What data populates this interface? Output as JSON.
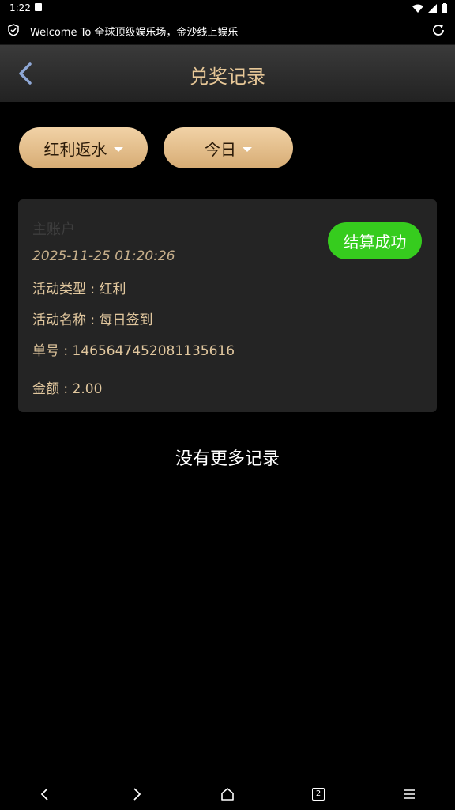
{
  "status_bar": {
    "time": "1:22"
  },
  "url_bar": {
    "text": "Welcome To 全球顶级娱乐场，金沙线上娱乐"
  },
  "header": {
    "title": "兑奖记录"
  },
  "filters": {
    "type_label": "红利返水",
    "date_label": "今日"
  },
  "record": {
    "account": "主账户",
    "datetime": "2025-11-25 01:20:26",
    "status": "结算成功",
    "activity_type": "活动类型 : 红利",
    "activity_name": "活动名称 : 每日签到",
    "order_no": "单号 : 1465647452081135616",
    "amount": "金额 : 2.00"
  },
  "footer_text": "没有更多记录",
  "bottom_nav": {
    "tabs_count": "2"
  },
  "colors": {
    "accent_gold": "#e8c898",
    "button_gold": "#d7ac74",
    "success_green": "#36cc1e",
    "card_bg": "#242424"
  },
  "icons": [
    "shield-icon",
    "reload-icon",
    "back-arrow-icon",
    "caret-down-icon",
    "chevron-left-icon",
    "chevron-right-icon",
    "home-icon",
    "tabs-icon",
    "menu-icon"
  ]
}
